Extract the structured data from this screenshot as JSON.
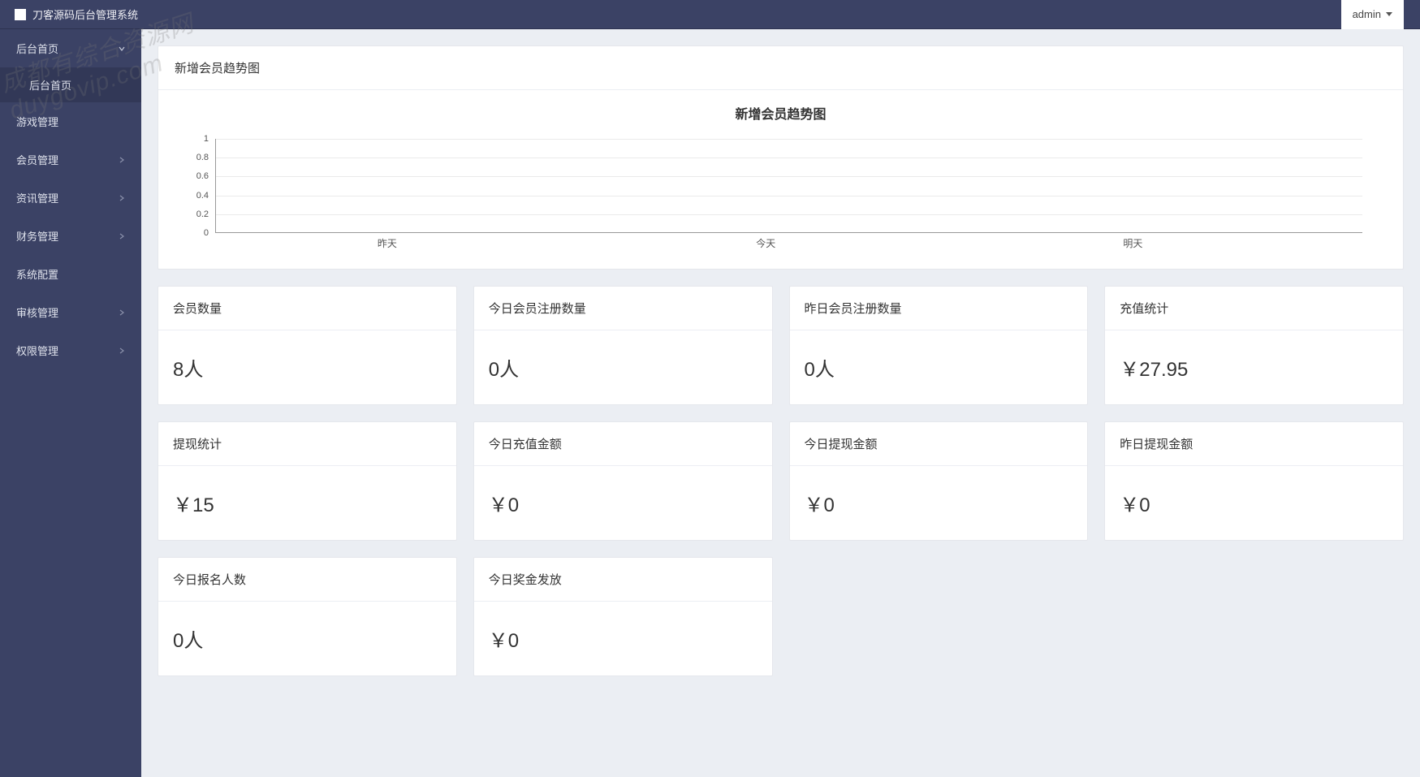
{
  "header": {
    "title": "刀客源码后台管理系统",
    "user": "admin"
  },
  "sidebar": {
    "items": [
      {
        "label": "后台首页",
        "expandable": true,
        "expanded": true,
        "sub": [
          {
            "label": "后台首页"
          }
        ]
      },
      {
        "label": "游戏管理",
        "expandable": false
      },
      {
        "label": "会员管理",
        "expandable": true
      },
      {
        "label": "资讯管理",
        "expandable": true
      },
      {
        "label": "财务管理",
        "expandable": true
      },
      {
        "label": "系统配置",
        "expandable": false
      },
      {
        "label": "审核管理",
        "expandable": true
      },
      {
        "label": "权限管理",
        "expandable": true
      }
    ]
  },
  "chart_panel": {
    "header": "新增会员趋势图"
  },
  "chart_data": {
    "type": "line",
    "title": "新增会员趋势图",
    "categories": [
      "昨天",
      "今天",
      "明天"
    ],
    "values": [
      0,
      0,
      0
    ],
    "ylim": [
      0,
      1
    ],
    "yticks": [
      0,
      0.2,
      0.4,
      0.6,
      0.8,
      1
    ],
    "xlabel": "",
    "ylabel": ""
  },
  "stats": [
    {
      "title": "会员数量",
      "value": "8人"
    },
    {
      "title": "今日会员注册数量",
      "value": "0人"
    },
    {
      "title": "昨日会员注册数量",
      "value": "0人"
    },
    {
      "title": "充值统计",
      "value": "￥27.95"
    },
    {
      "title": "提现统计",
      "value": "￥15"
    },
    {
      "title": "今日充值金额",
      "value": "￥0"
    },
    {
      "title": "今日提现金额",
      "value": "￥0"
    },
    {
      "title": "昨日提现金额",
      "value": "￥0"
    },
    {
      "title": "今日报名人数",
      "value": "0人"
    },
    {
      "title": "今日奖金发放",
      "value": "￥0"
    }
  ],
  "watermark": "成都有综合资源网\nduygovip.com"
}
